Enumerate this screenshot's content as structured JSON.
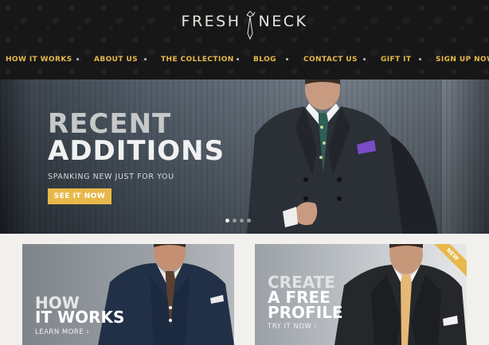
{
  "brand": {
    "part1": "FRESH",
    "part2": "NECK"
  },
  "nav": {
    "items": [
      {
        "label": "HOW IT WORKS"
      },
      {
        "label": "ABOUT US"
      },
      {
        "label": "THE COLLECTION"
      },
      {
        "label": "BLOG"
      },
      {
        "label": "CONTACT US"
      },
      {
        "label": "GIFT IT"
      },
      {
        "label": "SIGN UP NOW"
      }
    ]
  },
  "hero": {
    "title_line1": "RECENT",
    "title_line2": "ADDITIONS",
    "subtitle": "SPANKING NEW JUST FOR YOU",
    "button_label": "SEE IT NOW",
    "slides_total": 4,
    "active_slide": 1
  },
  "cards": {
    "how": {
      "line1": "HOW",
      "line2": "IT WORKS",
      "link": "LEARN MORE ›"
    },
    "profile": {
      "line1": "CREATE",
      "line2": "A FREE",
      "line3": "PROFILE",
      "link": "TRY IT NOW ›",
      "ribbon": "NEW"
    }
  },
  "colors": {
    "accent": "#e8b84a",
    "header_bg": "#171717"
  }
}
